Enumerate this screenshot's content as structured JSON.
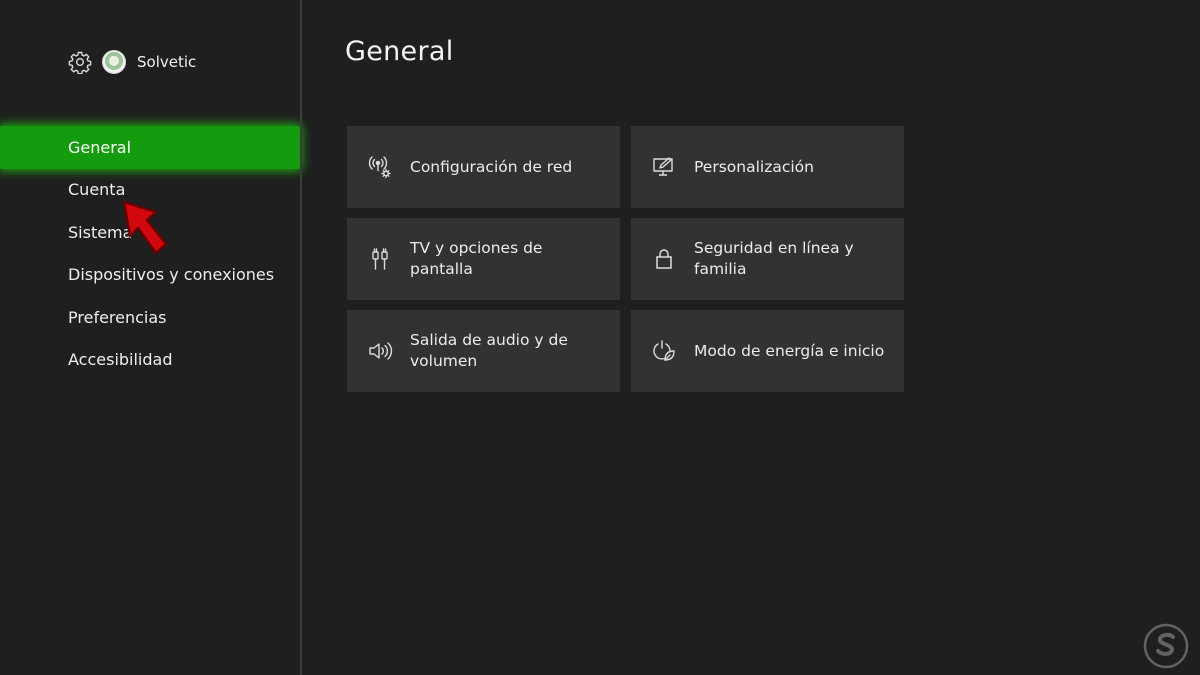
{
  "profile": {
    "user_name": "Solvetic",
    "settings_icon": "gear-icon"
  },
  "sidebar": {
    "items": [
      {
        "label": "General",
        "active": true
      },
      {
        "label": "Cuenta",
        "active": false
      },
      {
        "label": "Sistema",
        "active": false
      },
      {
        "label": "Dispositivos y conexiones",
        "active": false
      },
      {
        "label": "Preferencias",
        "active": false
      },
      {
        "label": "Accesibilidad",
        "active": false
      }
    ]
  },
  "main": {
    "title": "General",
    "tiles": [
      {
        "label": "Configuración de red",
        "icon": "network-settings-icon"
      },
      {
        "label": "Personalización",
        "icon": "personalization-icon"
      },
      {
        "label": "TV y opciones de pantalla",
        "icon": "tv-display-icon"
      },
      {
        "label": "Seguridad en línea y familia",
        "icon": "lock-icon"
      },
      {
        "label": "Salida de audio y de volumen",
        "icon": "speaker-icon"
      },
      {
        "label": "Modo de energía e inicio",
        "icon": "power-leaf-icon"
      }
    ]
  },
  "colors": {
    "accent_green": "#149c0e",
    "background": "#1f1f1f",
    "tile": "#323232",
    "arrow_red": "#d2080f"
  },
  "watermark": {
    "text": "Solvetic"
  }
}
